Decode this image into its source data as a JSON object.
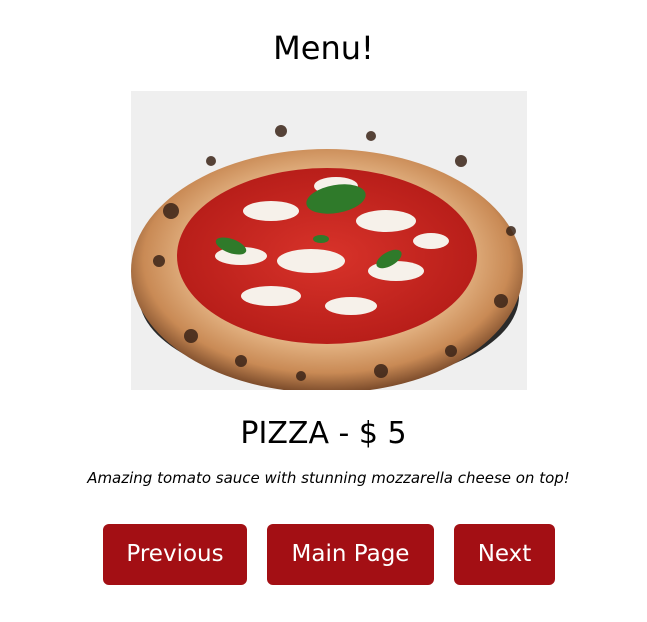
{
  "page": {
    "title": "Menu!"
  },
  "item": {
    "name": "PIZZA - $ 5",
    "description": "Amazing tomato sauce with stunning mozzarella cheese on top!",
    "image_icon": "pizza-photo"
  },
  "nav": {
    "previous_label": "Previous",
    "main_label": "Main Page",
    "next_label": "Next"
  },
  "colors": {
    "button_bg": "#a30f14",
    "button_text": "#ffffff"
  }
}
